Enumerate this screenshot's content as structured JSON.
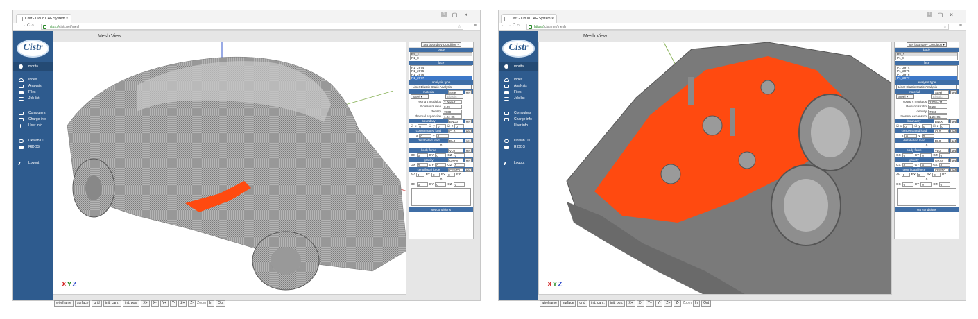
{
  "windows": [
    {
      "id": "left",
      "tab_title": "Cistr - Cloud CAE System",
      "url_https": "https://",
      "url_rest": "cistr.net/mesh",
      "user_badge": "1",
      "sidebar": {
        "logo": "Cistr",
        "user": "morita",
        "group1": [
          "Index",
          "Analysis",
          "Files",
          "Job list"
        ],
        "group2": [
          "Computers",
          "Charge info",
          "User info"
        ],
        "group3": [
          "Dkalab UT",
          "RIDOS"
        ],
        "logout": "Logout"
      },
      "view_title": "Mesh View",
      "xyz": [
        "X",
        "Y",
        "Z"
      ],
      "toolbar": [
        "wireframe",
        "surface",
        "grid",
        "init. cam.",
        "init. pos.",
        "X+",
        "X-",
        "Y+",
        "Y-",
        "Z+",
        "Z-"
      ],
      "zoom_label": "Zoom",
      "zoom_buttons": [
        "In",
        "Out"
      ],
      "panel": {
        "mode_select": "Set boundary Condition ▾",
        "body_header": "body",
        "body_items": [
          "PS_1",
          "P1_8"
        ],
        "face_header": "face",
        "face_items": [
          "P1_2974",
          "P1_2975",
          "P1_2976",
          "P1_2977"
        ],
        "analysis_header": "analysis type",
        "analysis_value": "Liner Elastic Static Analysis",
        "material_label": "material",
        "material_value": "Steel",
        "material_sel": "Steel ▾",
        "material_sel2": "Elastic",
        "youngs_label": "Young's modulus",
        "youngs_value": "2.06e+11",
        "poisson_label": "Poisson's ratio",
        "poisson_value": "0.29",
        "density_label": "density",
        "density_value": "7860",
        "thermal_label": "thermal expansion",
        "thermal_value": "1.2e-05",
        "boundary_label": "boundary",
        "boundary_value": "BND0",
        "bx": "x",
        "by": "y",
        "bz": "z",
        "bv1": "0",
        "bv2": "0",
        "bv3": "0",
        "conc_label": "concentrated load",
        "conc_value": "CL0",
        "px": "x",
        "py": "y",
        "conc_x": "0",
        "conc_y": "0",
        "dist_label": "distributed load",
        "dist_value": "DL0",
        "dist_val": "0",
        "body_force_label": "body force",
        "body_force_value": "VL0",
        "gx": "GX",
        "gy": "GY",
        "gz": "GZ",
        "bf_x": "0",
        "bf_y": "0",
        "bf_z": "0",
        "gravity_label": "gravity",
        "gravity_value": "GRAV",
        "gr_x": "0",
        "gr_y": "0",
        "gr_z": "0",
        "centri_label": "centrifugal force",
        "centri_value": "CENT0",
        "av": "AV",
        "pxl": "PX",
        "pyl": "PY",
        "pzl": "PZ",
        "cf_av": "0",
        "cf_px": "0",
        "cf_py": "0",
        "cf_val": "0",
        "ox": "OX",
        "oy": "OY",
        "oz": "OZ",
        "cf_ox": "0",
        "cf_oy": "0",
        "cf_oz": "0",
        "set_label": "set",
        "set_conditions": "set conditions"
      }
    },
    {
      "id": "right",
      "tab_title": "Cistr - Cloud CAE System",
      "url_https": "https://",
      "url_rest": "cistr.net/mesh",
      "user_badge": "1",
      "sidebar": {
        "logo": "Cistr",
        "user": "morita",
        "group1": [
          "Index",
          "Analysis",
          "Files",
          "Job list"
        ],
        "group2": [
          "Computers",
          "Charge info",
          "User info"
        ],
        "group3": [
          "Dkalab UT",
          "RIDOS"
        ],
        "logout": "Logout"
      },
      "view_title": "Mesh View",
      "xyz": [
        "X",
        "Y",
        "Z"
      ],
      "toolbar": [
        "wireframe",
        "surface",
        "grid",
        "init. cam.",
        "init. pos.",
        "X+",
        "X-",
        "Y+",
        "Y-",
        "Z+",
        "Z-"
      ],
      "zoom_label": "Zoom",
      "zoom_buttons": [
        "In",
        "Out"
      ],
      "panel": {
        "mode_select": "Set boundary Condition ▾",
        "body_header": "body",
        "body_items": [
          "PS_1",
          "P1_8"
        ],
        "face_header": "face",
        "face_items": [
          "P1_2974",
          "P1_2975",
          "P1_2976",
          "P1_2977"
        ],
        "analysis_header": "analysis type",
        "analysis_value": "Liner Elastic Static Analysis",
        "material_label": "material",
        "material_value": "Steel",
        "material_sel": "Steel ▾",
        "material_sel2": "Elastic",
        "youngs_label": "Young's modulus",
        "youngs_value": "2.06e+11",
        "poisson_label": "Poisson's ratio",
        "poisson_value": "0.29",
        "density_label": "density",
        "density_value": "7860",
        "thermal_label": "thermal expansion",
        "thermal_value": "1.2e-05",
        "boundary_label": "boundary",
        "boundary_value": "BND0",
        "bx": "x",
        "by": "y",
        "bz": "z",
        "bv1": "0",
        "bv2": "0",
        "bv3": "0",
        "conc_label": "concentrated load",
        "conc_value": "CL0",
        "px": "x",
        "py": "y",
        "conc_x": "0",
        "conc_y": "0",
        "dist_label": "distributed load",
        "dist_value": "DL0",
        "dist_val": "0",
        "body_force_label": "body force",
        "body_force_value": "VL0",
        "gx": "GX",
        "gy": "GY",
        "gz": "GZ",
        "bf_x": "0",
        "bf_y": "0",
        "bf_z": "0",
        "gravity_label": "gravity",
        "gravity_value": "GRAV",
        "gr_x": "0",
        "gr_y": "0",
        "gr_z": "0",
        "centri_label": "centrifugal force",
        "centri_value": "CENT0",
        "av": "AV",
        "pxl": "PX",
        "pyl": "PY",
        "pzl": "PZ",
        "cf_av": "0",
        "cf_px": "0",
        "cf_py": "0",
        "cf_val": "0",
        "ox": "OX",
        "oy": "OY",
        "oz": "OZ",
        "cf_ox": "0",
        "cf_oy": "0",
        "cf_oz": "0",
        "set_label": "set",
        "set_conditions": "set conditions"
      }
    }
  ],
  "colors": {
    "sidebar": "#2e5b8e",
    "panel_header": "#3f6ea6",
    "highlight": "#ff4a10",
    "mesh": "#8a8a8a"
  },
  "icons": [
    "user-icon",
    "cloud-icon",
    "grid-icon",
    "folder-icon",
    "list-icon",
    "computer-icon",
    "bank-icon",
    "person-icon",
    "tag-icon",
    "building-icon",
    "runner-icon"
  ]
}
